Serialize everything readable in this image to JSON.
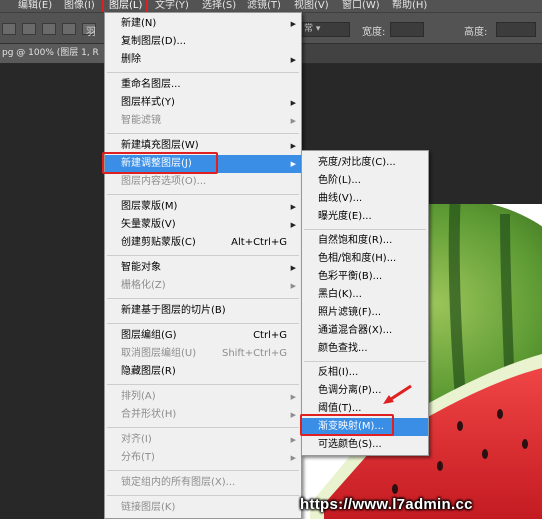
{
  "menubar": {
    "items": [
      "编辑(E)",
      "图像(I)",
      "图层(L)",
      "文字(Y)",
      "选择(S)",
      "滤镜(T)",
      "视图(V)",
      "窗口(W)",
      "帮助(H)"
    ]
  },
  "options": {
    "feather_label": "羽",
    "style_value": "常",
    "width_label": "宽度:",
    "height_label": "高度:"
  },
  "document": {
    "tab_title": "pg @ 100% (图层 1, R"
  },
  "layer_menu": {
    "items": [
      {
        "label": "新建(N)",
        "submenu": true
      },
      {
        "label": "复制图层(D)..."
      },
      {
        "label": "删除",
        "submenu": true
      },
      {
        "label": "重命名图层..."
      },
      {
        "label": "图层样式(Y)",
        "submenu": true
      },
      {
        "label": "智能滤镜",
        "disabled": true,
        "submenu": true
      },
      {
        "label": "新建填充图层(W)",
        "submenu": true
      },
      {
        "label": "新建调整图层(J)",
        "submenu": true,
        "highlighted": true
      },
      {
        "label": "图层内容选项(O)...",
        "disabled": true
      },
      {
        "label": "图层蒙版(M)",
        "submenu": true
      },
      {
        "label": "矢量蒙版(V)",
        "submenu": true
      },
      {
        "label": "创建剪贴蒙版(C)",
        "shortcut": "Alt+Ctrl+G"
      },
      {
        "label": "智能对象",
        "submenu": true
      },
      {
        "label": "栅格化(Z)",
        "disabled": true,
        "submenu": true
      },
      {
        "label": "新建基于图层的切片(B)"
      },
      {
        "label": "图层编组(G)",
        "shortcut": "Ctrl+G"
      },
      {
        "label": "取消图层编组(U)",
        "shortcut": "Shift+Ctrl+G",
        "disabled": true
      },
      {
        "label": "隐藏图层(R)"
      },
      {
        "label": "排列(A)",
        "disabled": true,
        "submenu": true
      },
      {
        "label": "合并形状(H)",
        "disabled": true,
        "submenu": true
      },
      {
        "label": "对齐(I)",
        "disabled": true,
        "submenu": true
      },
      {
        "label": "分布(T)",
        "disabled": true,
        "submenu": true
      },
      {
        "label": "锁定组内的所有图层(X)...",
        "disabled": true
      },
      {
        "label": "链接图层(K)",
        "disabled": true
      }
    ]
  },
  "adjust_submenu": {
    "items": [
      {
        "label": "亮度/对比度(C)..."
      },
      {
        "label": "色阶(L)..."
      },
      {
        "label": "曲线(V)..."
      },
      {
        "label": "曝光度(E)..."
      },
      {
        "label": "自然饱和度(R)..."
      },
      {
        "label": "色相/饱和度(H)..."
      },
      {
        "label": "色彩平衡(B)..."
      },
      {
        "label": "黑白(K)..."
      },
      {
        "label": "照片滤镜(F)..."
      },
      {
        "label": "通道混合器(X)..."
      },
      {
        "label": "颜色查找..."
      },
      {
        "label": "反相(I)..."
      },
      {
        "label": "色调分离(P)..."
      },
      {
        "label": "阈值(T)..."
      },
      {
        "label": "渐变映射(M)...",
        "highlighted": true
      },
      {
        "label": "可选颜色(S)..."
      }
    ]
  },
  "watermark": "https://www.l7admin.cc",
  "colors": {
    "highlight": "#3a8ee6",
    "red_box": "#e02020",
    "menu_bg": "#f0f0f0",
    "ui_dark": "#535353"
  }
}
